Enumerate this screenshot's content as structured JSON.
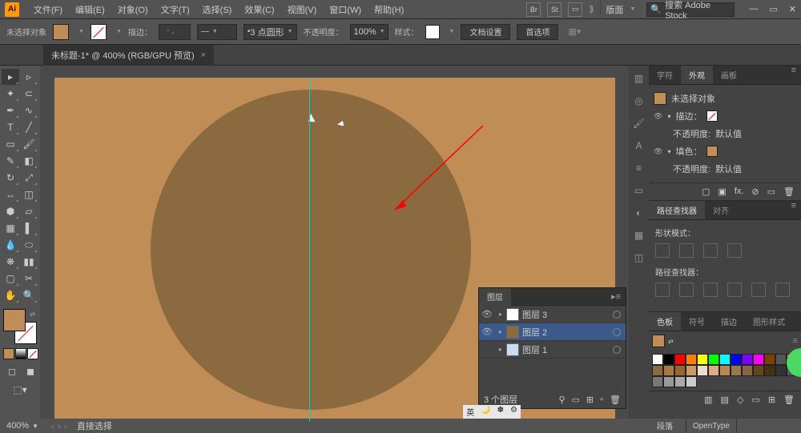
{
  "app": {
    "name": "Ai"
  },
  "menu": {
    "file": "文件(F)",
    "edit": "编辑(E)",
    "object": "对象(O)",
    "type": "文字(T)",
    "select": "选择(S)",
    "effect": "效果(C)",
    "view": "视图(V)",
    "window": "窗口(W)",
    "help": "帮助(H)"
  },
  "menubar_icons": {
    "br": "Br",
    "st": "St"
  },
  "workspace": {
    "preset": "版面",
    "search": "搜索 Adobe Stock"
  },
  "controlbar": {
    "no_selection": "未选择对象",
    "stroke_label": "描边：",
    "corner": "3 点圆形",
    "opacity_label": "不透明度：",
    "opacity_val": "100%",
    "style_label": "样式：",
    "doc_setup": "文档设置",
    "prefs": "首选项"
  },
  "tab": {
    "title": "未标题-1* @ 400% (RGB/GPU 预览)"
  },
  "appearance": {
    "tab_char": "字符",
    "tab_appear": "外观",
    "tab_artboard": "画板",
    "no_sel": "未选择对象",
    "stroke": "描边：",
    "opacity": "不透明度:",
    "default": "默认值",
    "fill": "填色："
  },
  "pathfinder": {
    "tab_pf": "路径查找器",
    "tab_align": "对齐",
    "shape_mode": "形状模式：",
    "pf_label": "路径查找器："
  },
  "swatches": {
    "tab_sw": "色板",
    "tab_sym": "符号",
    "tab_br": "描边",
    "tab_gfx": "图形样式"
  },
  "layers": {
    "tab": "图层",
    "l1": "图层 3",
    "l2": "图层 2",
    "l3": "图层 1",
    "count": "3 个图层"
  },
  "status": {
    "zoom": "400%",
    "tool": "直接选择"
  },
  "footer": {
    "para": "段落",
    "opentype": "OpenType"
  },
  "ime": {
    "lang": "英"
  },
  "colors": {
    "swatch_row1": [
      "#ffffff",
      "#000000",
      "#ff0000",
      "#ff8000",
      "#ffff00",
      "#00ff00",
      "#00ffff",
      "#0000ff",
      "#8000ff",
      "#ff00ff",
      "#804000",
      "#555555"
    ],
    "swatch_row2": [
      "#c18d57",
      "#8b6a3f",
      "#aa7744",
      "#996633",
      "#cc9966",
      "#eeddcc",
      "#ddaa88",
      "#bb8855",
      "#997755",
      "#886644",
      "#664422",
      "#443311"
    ],
    "swatch_row3": [
      "#333333",
      "#555555",
      "#777777",
      "#999999",
      "#aaaaaa",
      "#cccccc"
    ]
  }
}
